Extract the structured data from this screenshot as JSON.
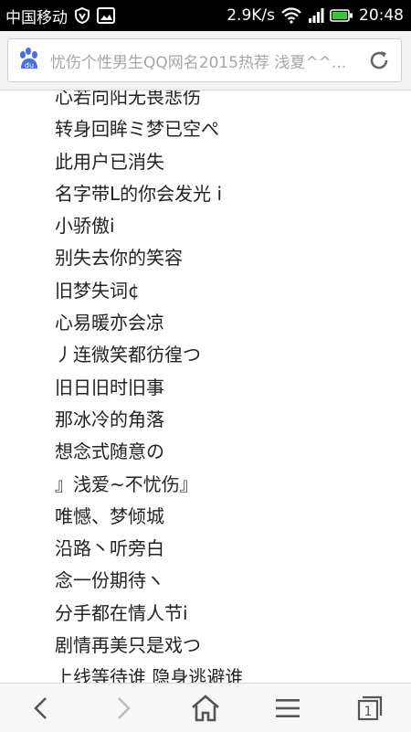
{
  "status_bar": {
    "carrier": "中国移动",
    "network_speed": "2.9K/s",
    "time": "20:48",
    "icons": [
      "vpn-shield-icon",
      "image-notification-icon",
      "wifi-icon",
      "signal-icon",
      "battery-icon"
    ]
  },
  "address_bar": {
    "title": "忧伤个性男生QQ网名2015热荐 浅夏^^...",
    "logo_text": "du",
    "icons": [
      "baidu-paw-icon",
      "reload-icon"
    ]
  },
  "names": [
    "心若向阳无畏悲伤",
    "转身回眸ミ梦已空ぺ",
    "此用户已消失",
    "名字带L的你会发光 i",
    "小骄傲i",
    "别失去你的笑容",
    "旧梦失词¢",
    "心易暖亦会凉",
    "丿连微笑都彷徨つ",
    "旧日旧时旧事",
    "那冰冷的角落",
    "想念式随意の",
    "』浅爱~不忧伤』",
    "唯憾、梦倾城",
    "沿路丶听旁白",
    "念一份期待ヽ",
    "分手都在情人节i",
    "剧情再美只是戏つ",
    "上线等待谁 隐身逃避谁"
  ],
  "toolbar": {
    "icons": [
      "back-arrow-icon",
      "forward-arrow-icon",
      "home-icon",
      "menu-icon",
      "tabs-icon"
    ],
    "tabs_count": "1"
  },
  "colors": {
    "status_bar_bg": "#000000",
    "battery_green": "#3cc43c",
    "title_gray": "#a6a6a6",
    "icon_blue": "#4a6fd6"
  }
}
